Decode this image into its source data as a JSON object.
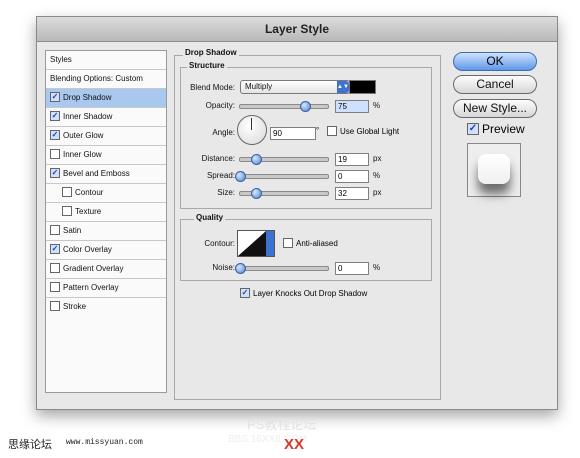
{
  "dialog": {
    "title": "Layer Style"
  },
  "sidebar": {
    "header": "Styles",
    "blending": "Blending Options: Custom",
    "items": [
      {
        "label": "Drop Shadow",
        "checked": true
      },
      {
        "label": "Inner Shadow",
        "checked": true
      },
      {
        "label": "Outer Glow",
        "checked": true
      },
      {
        "label": "Inner Glow",
        "checked": false
      },
      {
        "label": "Bevel and Emboss",
        "checked": true
      },
      {
        "label": "Contour",
        "checked": false
      },
      {
        "label": "Texture",
        "checked": false
      },
      {
        "label": "Satin",
        "checked": false
      },
      {
        "label": "Color Overlay",
        "checked": true
      },
      {
        "label": "Gradient Overlay",
        "checked": false
      },
      {
        "label": "Pattern Overlay",
        "checked": false
      },
      {
        "label": "Stroke",
        "checked": false
      }
    ]
  },
  "panel": {
    "title": "Drop Shadow",
    "structure": {
      "title": "Structure",
      "blend_mode_label": "Blend Mode:",
      "blend_mode_value": "Multiply",
      "shadow_color": "#000000",
      "opacity_label": "Opacity:",
      "opacity_value": "75",
      "opacity_unit": "%",
      "angle_label": "Angle:",
      "angle_value": "90",
      "angle_unit": "°",
      "global_light_label": "Use Global Light",
      "distance_label": "Distance:",
      "distance_value": "19",
      "distance_unit": "px",
      "spread_label": "Spread:",
      "spread_value": "0",
      "spread_unit": "%",
      "size_label": "Size:",
      "size_value": "32",
      "size_unit": "px"
    },
    "quality": {
      "title": "Quality",
      "contour_label": "Contour:",
      "anti_aliased_label": "Anti-aliased",
      "noise_label": "Noise:",
      "noise_value": "0",
      "noise_unit": "%"
    },
    "knockout_label": "Layer Knocks Out Drop Shadow"
  },
  "buttons": {
    "ok": "OK",
    "cancel": "Cancel",
    "new_style": "New Style..."
  },
  "preview_label": "Preview",
  "footer": {
    "site_left": "思缘论坛",
    "site_url": "www.missyuan.com",
    "forum": "PS教程论坛",
    "xx": "XX",
    "faint": "BBS.16XX8.COM"
  }
}
